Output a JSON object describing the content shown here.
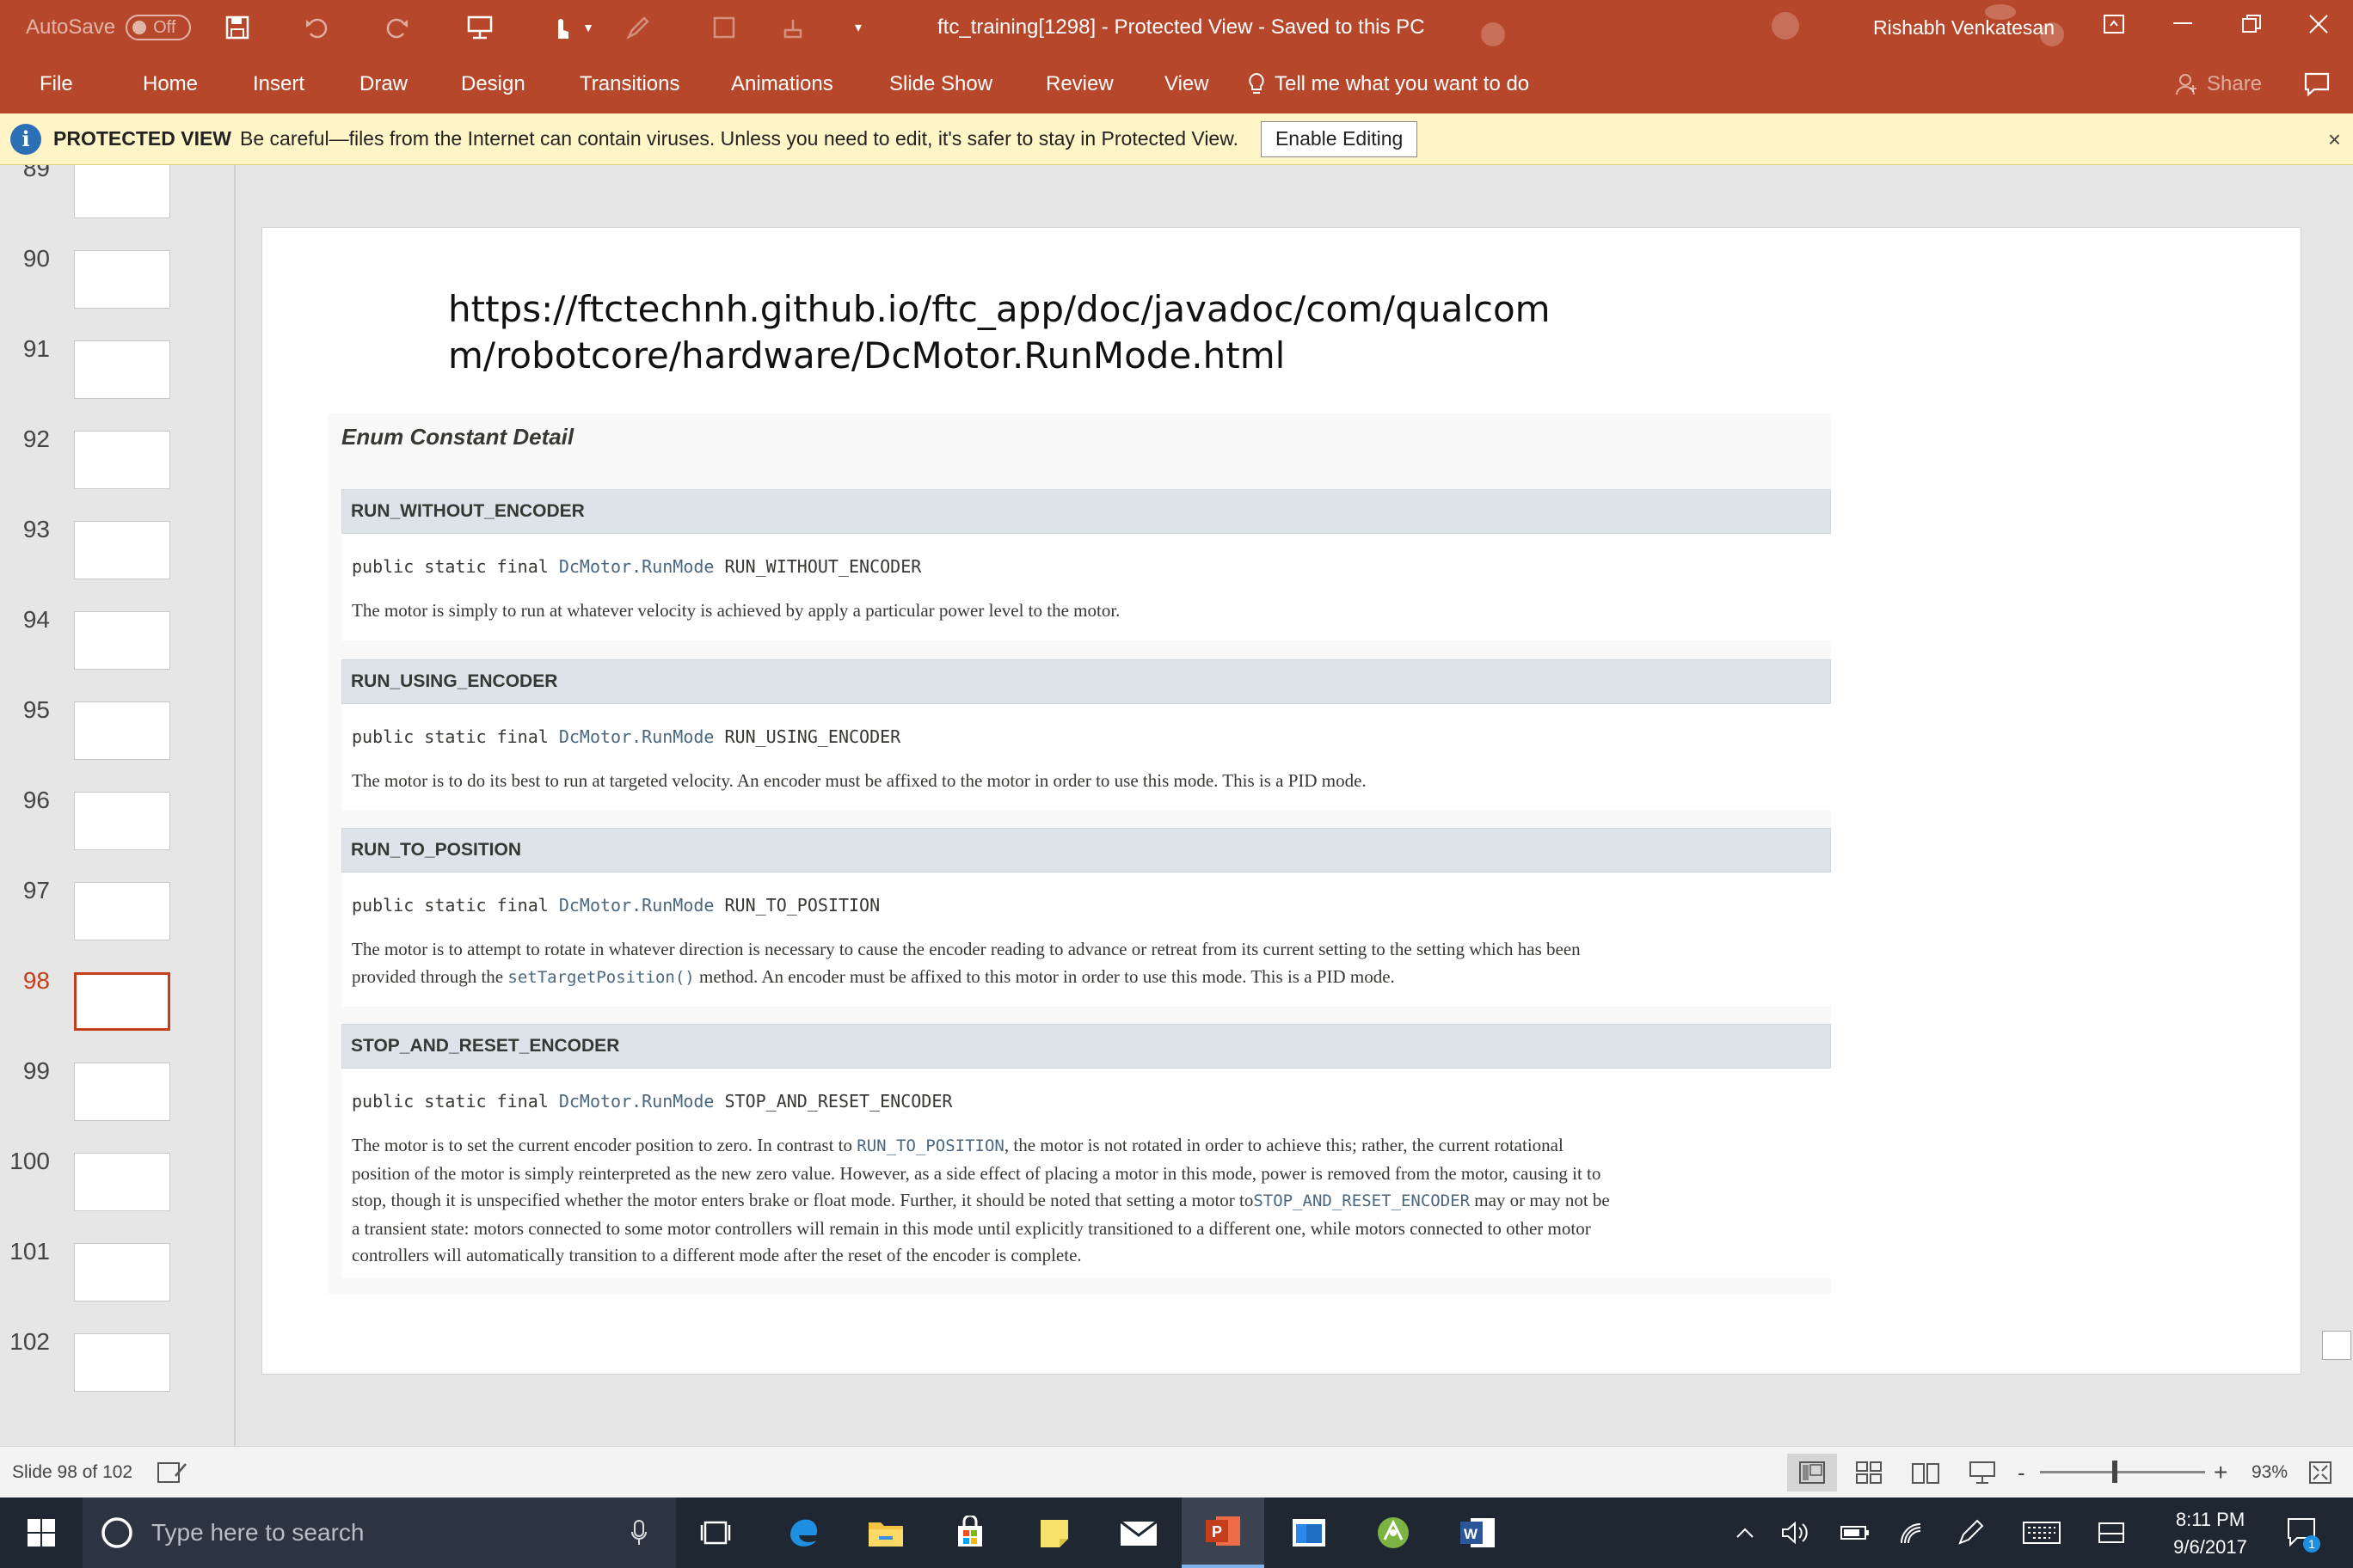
{
  "titlebar": {
    "autosave_label": "AutoSave",
    "autosave_state": "Off",
    "document_title": "ftc_training[1298]  -  Protected View  -  Saved to this PC",
    "user_name": "Rishabh Venkatesan"
  },
  "ribbon": {
    "tabs": [
      "File",
      "Home",
      "Insert",
      "Draw",
      "Design",
      "Transitions",
      "Animations",
      "Slide Show",
      "Review",
      "View"
    ],
    "tell_me": "Tell me what you want to do",
    "share": "Share"
  },
  "protected_view": {
    "title": "PROTECTED VIEW",
    "message": "Be careful—files from the Internet can contain viruses. Unless you need to edit, it's safer to stay in Protected View.",
    "enable_button": "Enable Editing",
    "close_glyph": "×"
  },
  "thumbnails": {
    "numbers": [
      "89",
      "90",
      "91",
      "92",
      "93",
      "94",
      "95",
      "96",
      "97",
      "98",
      "99",
      "100",
      "101",
      "102"
    ],
    "current": "98"
  },
  "slide": {
    "url_line1": "https://ftctechnh.github.io/ftc_app/doc/javadoc/com/qualcom",
    "url_line2": "m/robotcore/hardware/DcMotor.RunMode.html",
    "javadoc": {
      "heading": "Enum Constant Detail",
      "sig_prefix": "public static final ",
      "sig_type": "DcMotor.RunMode",
      "sections": [
        {
          "name": "RUN_WITHOUT_ENCODER",
          "desc": "The motor is simply to run at whatever velocity is achieved by apply a particular power level to the motor."
        },
        {
          "name": "RUN_USING_ENCODER",
          "desc": "The motor is to do its best to run at targeted velocity. An encoder must be affixed to the motor in order to use this mode. This is a PID mode."
        },
        {
          "name": "RUN_TO_POSITION",
          "desc_line1": "The motor is to attempt to rotate in whatever direction is necessary to cause the encoder reading to advance or retreat from its current setting to the setting which has been",
          "desc_pre": "provided through the ",
          "desc_link": "setTargetPosition()",
          "desc_post": " method. An encoder must be affixed to this motor in order to use this mode. This is a PID mode."
        },
        {
          "name": "STOP_AND_RESET_ENCODER",
          "desc_a": "The motor is to set the current encoder position to zero. In contrast to ",
          "desc_link1": "RUN_TO_POSITION",
          "desc_b": ", the motor is not rotated in order to achieve this; rather, the current rotational",
          "desc_c": "position of the motor is simply reinterpreted as the new zero value. However, as a side effect of placing a motor in this mode, power is removed from the motor, causing it to",
          "desc_d": "stop, though it is unspecified whether the motor enters brake or float mode. Further, it should be noted that setting a motor to",
          "desc_link2": "STOP_AND_RESET_ENCODER",
          "desc_e": " may or may not be",
          "desc_f": "a transient state: motors connected to some motor controllers will remain in this mode until explicitly transitioned to a different one, while motors connected to other motor",
          "desc_g": "controllers will automatically transition to a different mode after the reset of the encoder is complete."
        }
      ]
    }
  },
  "statusbar": {
    "slide_counter": "Slide 98 of 102",
    "zoom": "93%",
    "zoom_minus": "-",
    "zoom_plus": "+"
  },
  "taskbar": {
    "search_placeholder": "Type here to search",
    "time": "8:11 PM",
    "date": "9/6/2017",
    "notification_count": "1"
  },
  "colors": {
    "accent": "#b7472a",
    "current_slide": "#c43e1c",
    "pv_bar": "#fff5c7",
    "javadoc_header": "#dee3e9",
    "javadoc_link": "#4a6782"
  }
}
